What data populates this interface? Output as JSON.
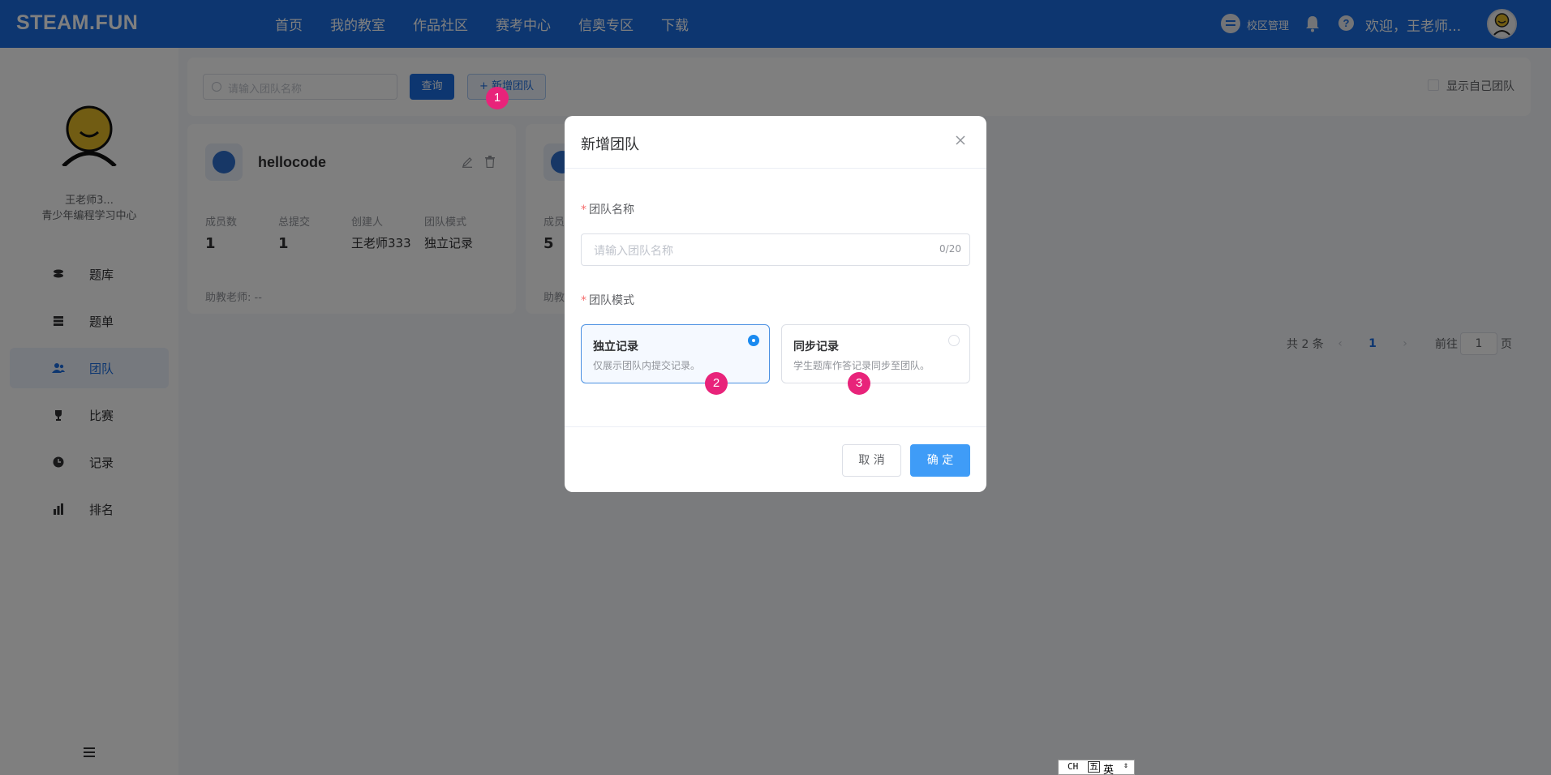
{
  "header": {
    "logo": "STEAM.FUN",
    "nav": [
      "首页",
      "我的教室",
      "作品社区",
      "赛考中心",
      "信奥专区",
      "下载"
    ],
    "campus_label": "校区管理",
    "welcome": "欢迎，王老师..."
  },
  "sidebar": {
    "name": "王老师3...",
    "org": "青少年编程学习中心",
    "items": [
      {
        "label": "题库",
        "icon": "database-icon"
      },
      {
        "label": "题单",
        "icon": "list-icon"
      },
      {
        "label": "团队",
        "icon": "team-icon",
        "active": true
      },
      {
        "label": "比赛",
        "icon": "trophy-icon"
      },
      {
        "label": "记录",
        "icon": "clock-icon"
      },
      {
        "label": "排名",
        "icon": "bar-chart-icon"
      }
    ]
  },
  "toolbar": {
    "search_placeholder": "请输入团队名称",
    "query_label": "查询",
    "add_label": "+ 新增团队",
    "self_team_label": "显示自己团队"
  },
  "teams": [
    {
      "name": "hellocode",
      "member_label": "成员数",
      "members": "1",
      "submit_label": "总提交",
      "submits": "1",
      "creator_label": "创建人",
      "creator": "王老师333",
      "mode_label": "团队模式",
      "mode": "独立记录",
      "assistant": "助教老师:  --"
    },
    {
      "member_label": "成员",
      "members": "5",
      "assistant": "助教"
    }
  ],
  "pagination": {
    "total": "共 2 条",
    "prev": "‹",
    "current": "1",
    "next": "›",
    "goto_label": "前往",
    "goto_value": "1",
    "page_unit": "页"
  },
  "dialog": {
    "title": "新增团队",
    "name_label": "团队名称",
    "name_placeholder": "请输入团队名称",
    "name_counter": "0/20",
    "mode_label": "团队模式",
    "options": [
      {
        "title": "独立记录",
        "desc": "仅展示团队内提交记录。",
        "selected": true
      },
      {
        "title": "同步记录",
        "desc": "学生题库作答记录同步至团队。",
        "selected": false
      }
    ],
    "cancel": "取 消",
    "confirm": "确 定"
  },
  "markers": [
    "1",
    "2",
    "3"
  ],
  "ime": {
    "mode": "CH",
    "layout": "五",
    "lang": "英"
  },
  "colors": {
    "brand": "#1a6de0",
    "primary_button": "#3f9cf7",
    "marker": "#e8237a",
    "required": "#f56c6c"
  }
}
